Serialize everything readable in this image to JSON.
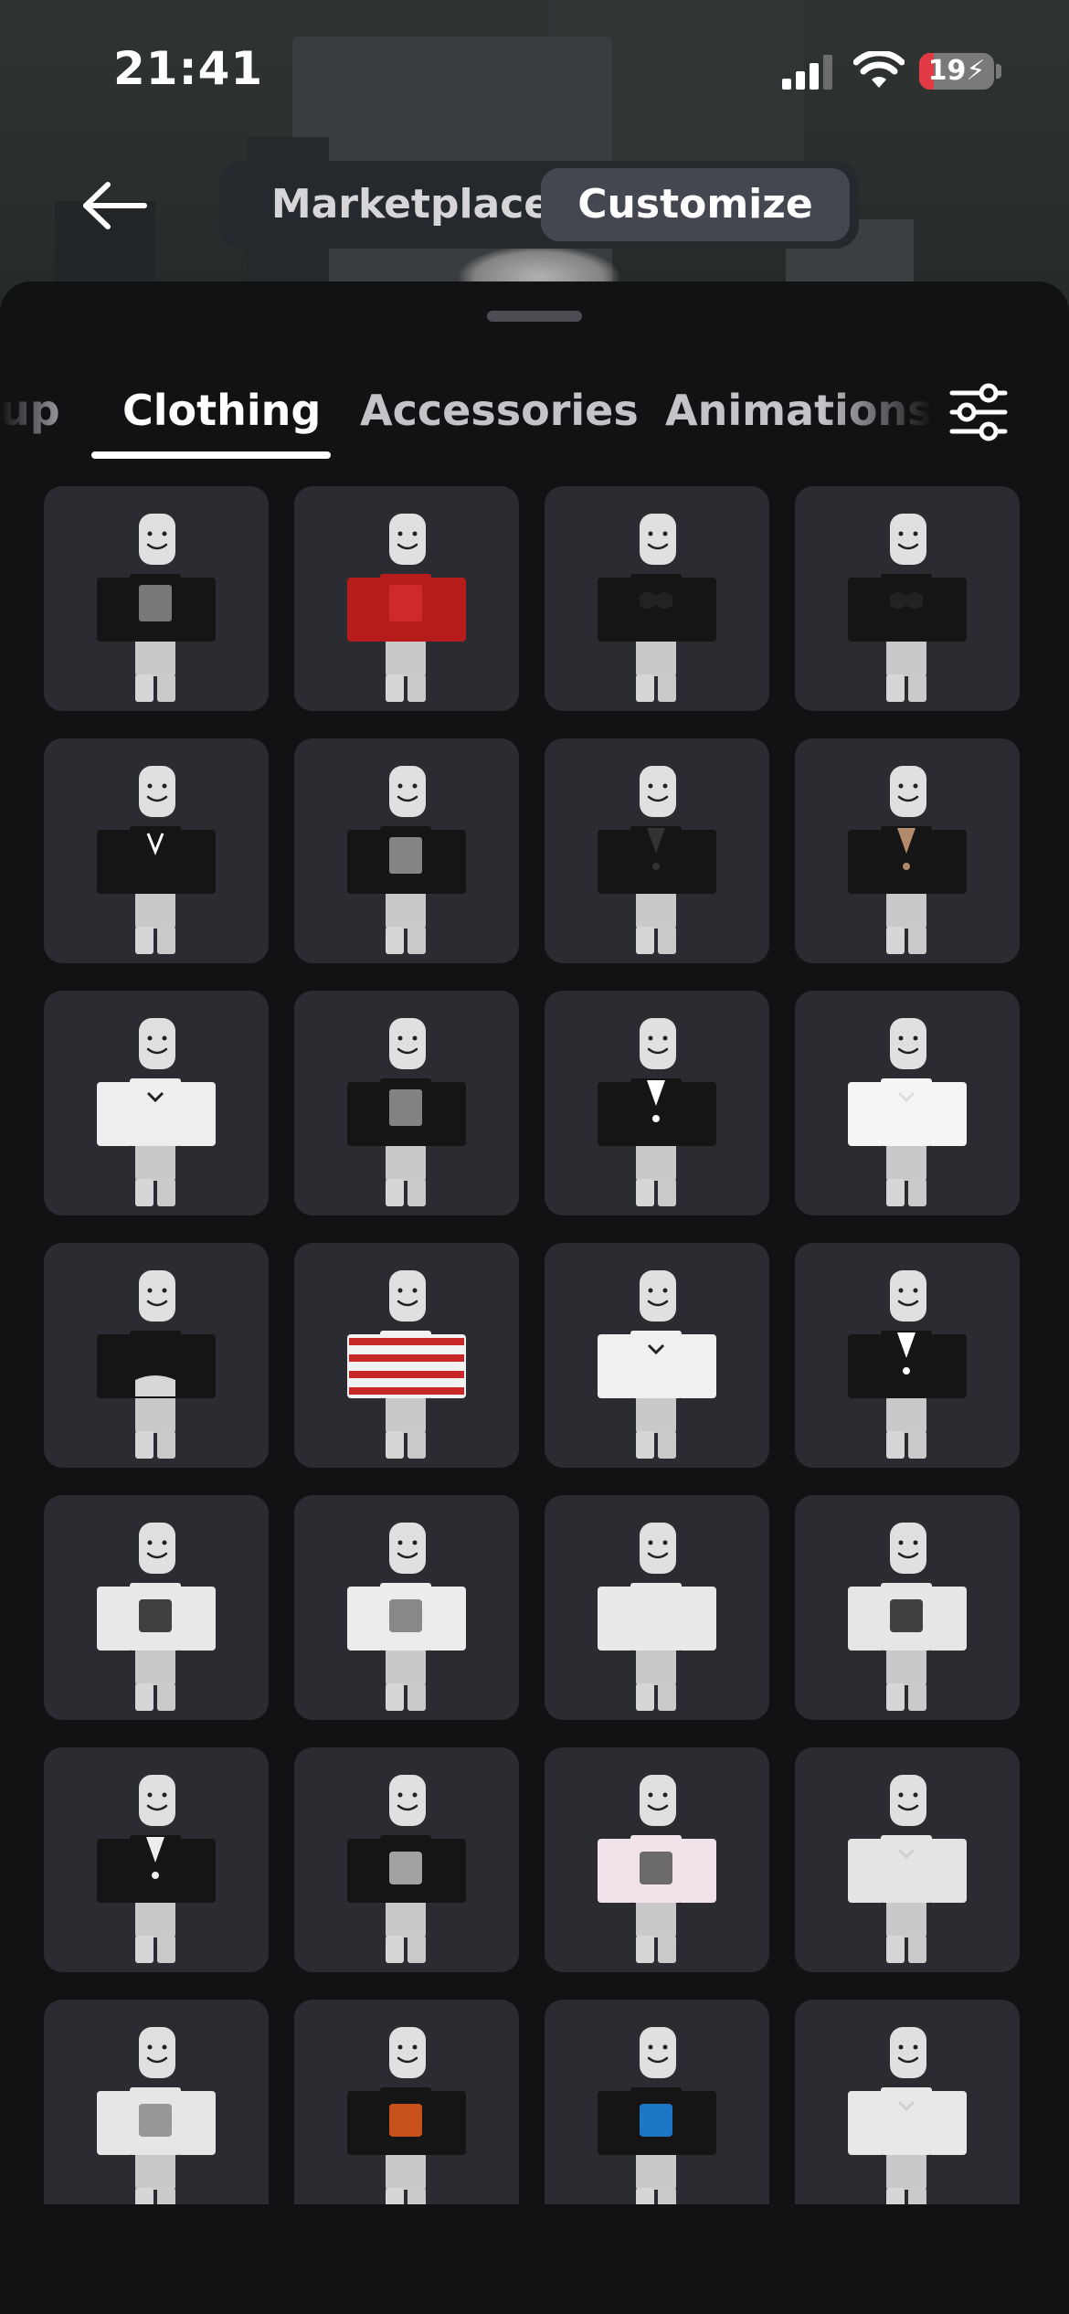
{
  "status_bar": {
    "time": "21:41",
    "battery": "19",
    "battery_level": 0.19
  },
  "header": {
    "segments": [
      {
        "label": "Marketplace",
        "selected": false
      },
      {
        "label": "Customize",
        "selected": true
      }
    ]
  },
  "tabs": [
    {
      "label": "up",
      "selected": false
    },
    {
      "label": "Clothing",
      "selected": true
    },
    {
      "label": "Accessories",
      "selected": false
    },
    {
      "label": "Animations",
      "selected": false
    }
  ],
  "icons": {
    "back": "back-arrow-icon",
    "filter": "sliders-icon",
    "signal": "cellular-signal-icon",
    "wifi": "wifi-icon",
    "battery": "battery-charging-icon"
  },
  "colors": {
    "sheet": "#111214",
    "tile": "#2b2c31",
    "accent_battery": "#e23a44"
  },
  "items": [
    {
      "style": "shirt",
      "color": "#151515",
      "detail": "#bbbbbb"
    },
    {
      "style": "shirt",
      "color": "#b71c1c",
      "detail": "#d33"
    },
    {
      "style": "bikini",
      "color": "#151515",
      "detail": "#222"
    },
    {
      "style": "bikini",
      "color": "#151515",
      "detail": "#222"
    },
    {
      "style": "vest",
      "color": "#151515",
      "detail": "#fff"
    },
    {
      "style": "shirt",
      "color": "#151515",
      "detail": "#cfcfcf"
    },
    {
      "style": "suit",
      "color": "#151515",
      "detail": "#333"
    },
    {
      "style": "suit",
      "color": "#151515",
      "detail": "#b08a6a"
    },
    {
      "style": "white",
      "color": "#eeeeee",
      "detail": "#222"
    },
    {
      "style": "shirt",
      "color": "#151515",
      "detail": "#ccc"
    },
    {
      "style": "suit",
      "color": "#151515",
      "detail": "#fff"
    },
    {
      "style": "white",
      "color": "#f5f5f5",
      "detail": "#ddd"
    },
    {
      "style": "crop",
      "color": "#151515",
      "detail": "#151515"
    },
    {
      "style": "stripes",
      "color": "#f2f2f2",
      "detail": "#c62828"
    },
    {
      "style": "white",
      "color": "#f0f0f0",
      "detail": "#222"
    },
    {
      "style": "suit",
      "color": "#151515",
      "detail": "#fff"
    },
    {
      "style": "print",
      "color": "#e8e8e8",
      "detail": "#222"
    },
    {
      "style": "print",
      "color": "#ececec",
      "detail": "#777"
    },
    {
      "style": "white",
      "color": "#e9e9e9",
      "detail": "#e9e9e9"
    },
    {
      "style": "print",
      "color": "#e6e6e6",
      "detail": "#222"
    },
    {
      "style": "suit",
      "color": "#151515",
      "detail": "#eee"
    },
    {
      "style": "print",
      "color": "#151515",
      "detail": "#bbb"
    },
    {
      "style": "print",
      "color": "#f1e3ea",
      "detail": "#555"
    },
    {
      "style": "white",
      "color": "#e4e4e4",
      "detail": "#cfcfcf"
    },
    {
      "style": "print",
      "color": "#e6e6e6",
      "detail": "#888"
    },
    {
      "style": "print",
      "color": "#151515",
      "detail": "#e85a1c"
    },
    {
      "style": "print",
      "color": "#151515",
      "detail": "#1e88e5"
    },
    {
      "style": "white",
      "color": "#e8e8e8",
      "detail": "#cfcfcf"
    }
  ]
}
